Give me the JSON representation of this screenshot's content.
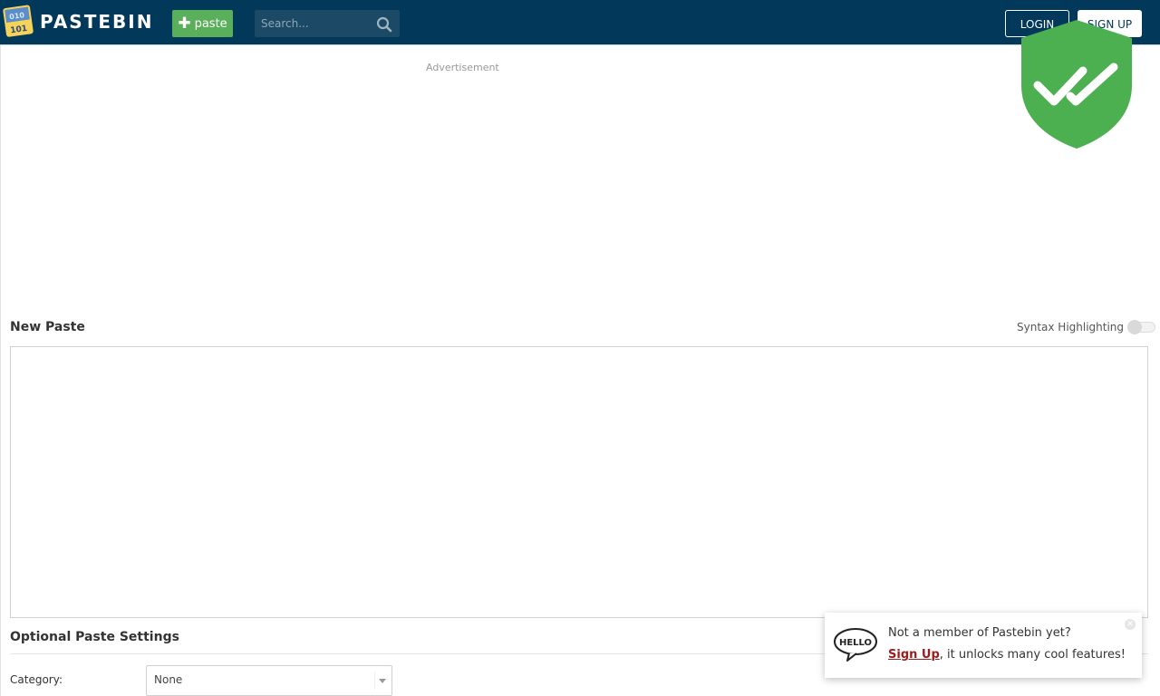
{
  "header": {
    "brand": "PASTEBIN",
    "paste_button_label": "paste",
    "search_placeholder": "Search...",
    "login_label": "LOGIN",
    "signup_label": "SIGN UP",
    "background_color": "#02385a",
    "paste_button_color": "#5aaf5a"
  },
  "ad": {
    "label": "Advertisement"
  },
  "overlay": {
    "icon": "verified-shield-check-icon",
    "color": "#4caf50"
  },
  "new_paste": {
    "title": "New Paste",
    "syntax_highlighting_label": "Syntax Highlighting",
    "syntax_highlighting_on": false,
    "content": ""
  },
  "optional_settings": {
    "title": "Optional Paste Settings",
    "category_label": "Category:",
    "category_value": "None"
  },
  "signup_popup": {
    "question": "Not a member of Pastebin yet?",
    "link_text": "Sign Up",
    "rest_text": ", it unlocks many cool features!",
    "icon": "hello-speech-bubble-icon",
    "close_icon": "close-icon"
  }
}
